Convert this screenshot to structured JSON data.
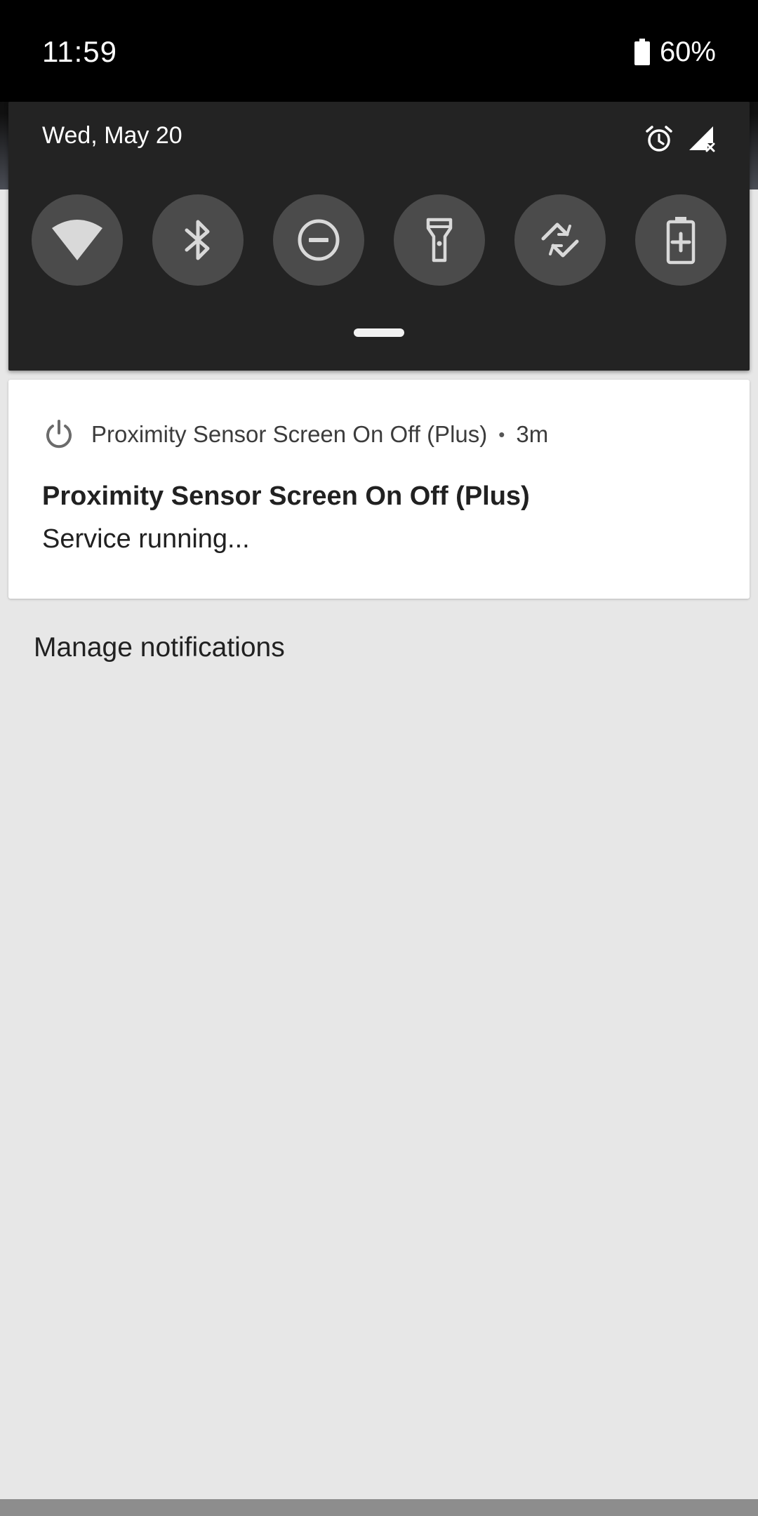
{
  "status_bar": {
    "time": "11:59",
    "battery_percent": "60%",
    "battery_icon": "battery-icon"
  },
  "quick_settings": {
    "date": "Wed, May 20",
    "status_icons": [
      "alarm-icon",
      "signal-no-service-icon"
    ],
    "tiles": [
      {
        "name": "wifi",
        "icon": "wifi-icon"
      },
      {
        "name": "bluetooth",
        "icon": "bluetooth-icon"
      },
      {
        "name": "do-not-disturb",
        "icon": "do-not-disturb-icon"
      },
      {
        "name": "flashlight",
        "icon": "flashlight-icon"
      },
      {
        "name": "auto-rotate",
        "icon": "auto-rotate-icon"
      },
      {
        "name": "battery-saver",
        "icon": "battery-saver-icon"
      }
    ],
    "colors": {
      "panel": "#232323",
      "tile": "#4b4b4b",
      "icon": "#d6d6d6"
    }
  },
  "notification": {
    "app_icon": "power-icon",
    "app_name": "Proximity Sensor Screen On Off (Plus)",
    "separator": "•",
    "time_ago": "3m",
    "title": "Proximity Sensor Screen On Off (Plus)",
    "text": "Service running..."
  },
  "footer": {
    "manage_label": "Manage notifications"
  }
}
